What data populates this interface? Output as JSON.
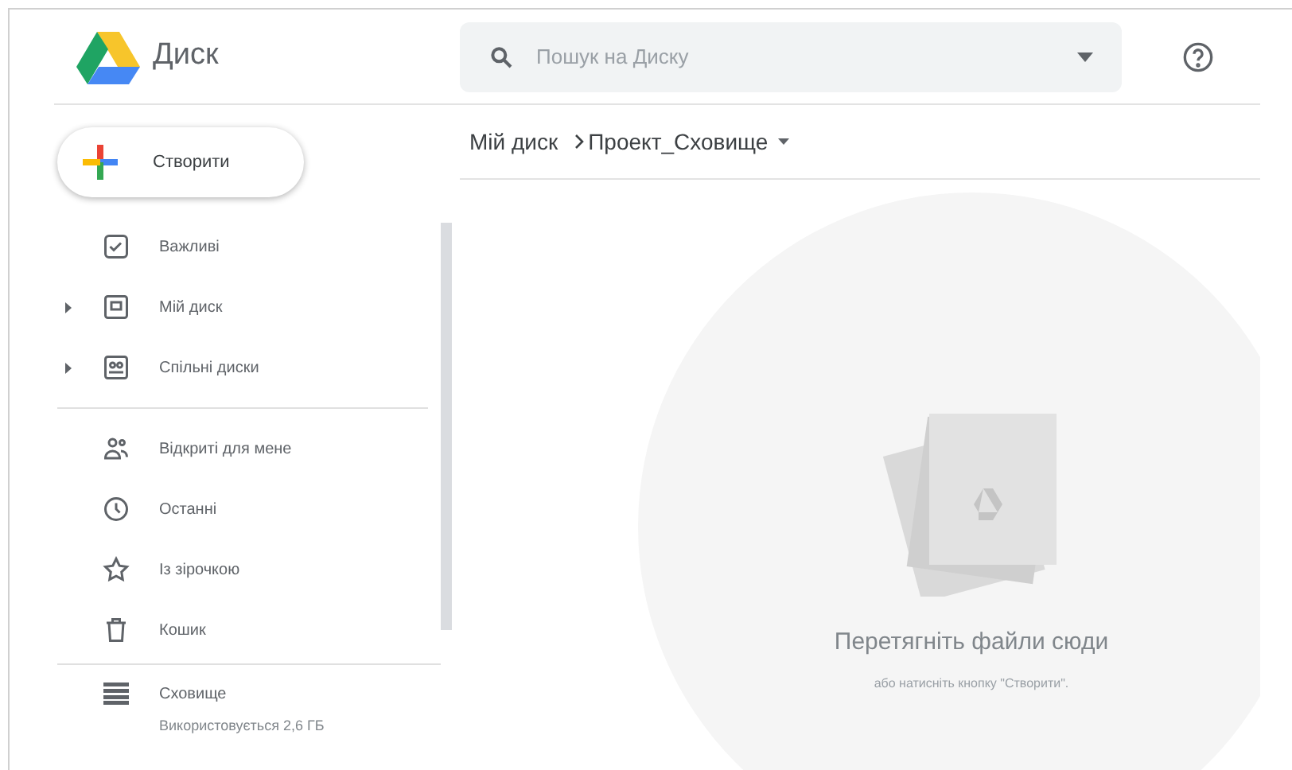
{
  "app": {
    "name": "Диск"
  },
  "search": {
    "placeholder": "Пошук на Диску"
  },
  "create_button": {
    "label": "Створити"
  },
  "sidebar": {
    "groups": [
      [
        {
          "kind": "priority",
          "label": "Важливі",
          "expandable": false
        },
        {
          "kind": "drive",
          "label": "Мій диск",
          "expandable": true
        },
        {
          "kind": "shared-drives",
          "label": "Спільні диски",
          "expandable": true
        }
      ],
      [
        {
          "kind": "shared",
          "label": "Відкриті для мене",
          "expandable": false
        },
        {
          "kind": "recent",
          "label": "Останні",
          "expandable": false
        },
        {
          "kind": "starred",
          "label": "Із зірочкою",
          "expandable": false
        },
        {
          "kind": "trash",
          "label": "Кошик",
          "expandable": false
        }
      ]
    ],
    "storage": {
      "label": "Сховище",
      "usage": "Використовується 2,6 ГБ"
    }
  },
  "breadcrumb": [
    "Мій диск",
    "Проект_Сховище"
  ],
  "empty_state": {
    "title": "Перетягніть файли сюди",
    "subtitle": "або натисніть кнопку \"Створити\"."
  }
}
